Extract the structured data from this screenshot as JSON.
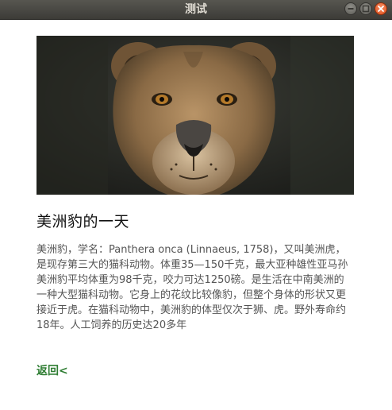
{
  "window": {
    "title": "测试",
    "controls": {
      "minimize_icon": "minimize-icon",
      "maximize_icon": "maximize-icon",
      "close_icon": "close-icon"
    }
  },
  "article": {
    "image": "lioness-photo",
    "title": "美洲豹的一天",
    "body": "美洲豹，学名：Panthera onca (Linnaeus, 1758)，又叫美洲虎，是现存第三大的猫科动物。体重35—150千克，最大亚种雄性亚马孙美洲豹平均体重为98千克，咬力可达1250磅。是生活在中南美洲的一种大型猫科动物。它身上的花纹比较像豹，但整个身体的形状又更接近于虎。在猫科动物中，美洲豹的体型仅次于狮、虎。野外寿命约18年。人工饲养的历史达20多年",
    "back_label": "返回<"
  },
  "colors": {
    "titlebar": "#3c3b37",
    "close_button": "#e05420",
    "link": "#2e7d32",
    "body_text": "#555555"
  }
}
